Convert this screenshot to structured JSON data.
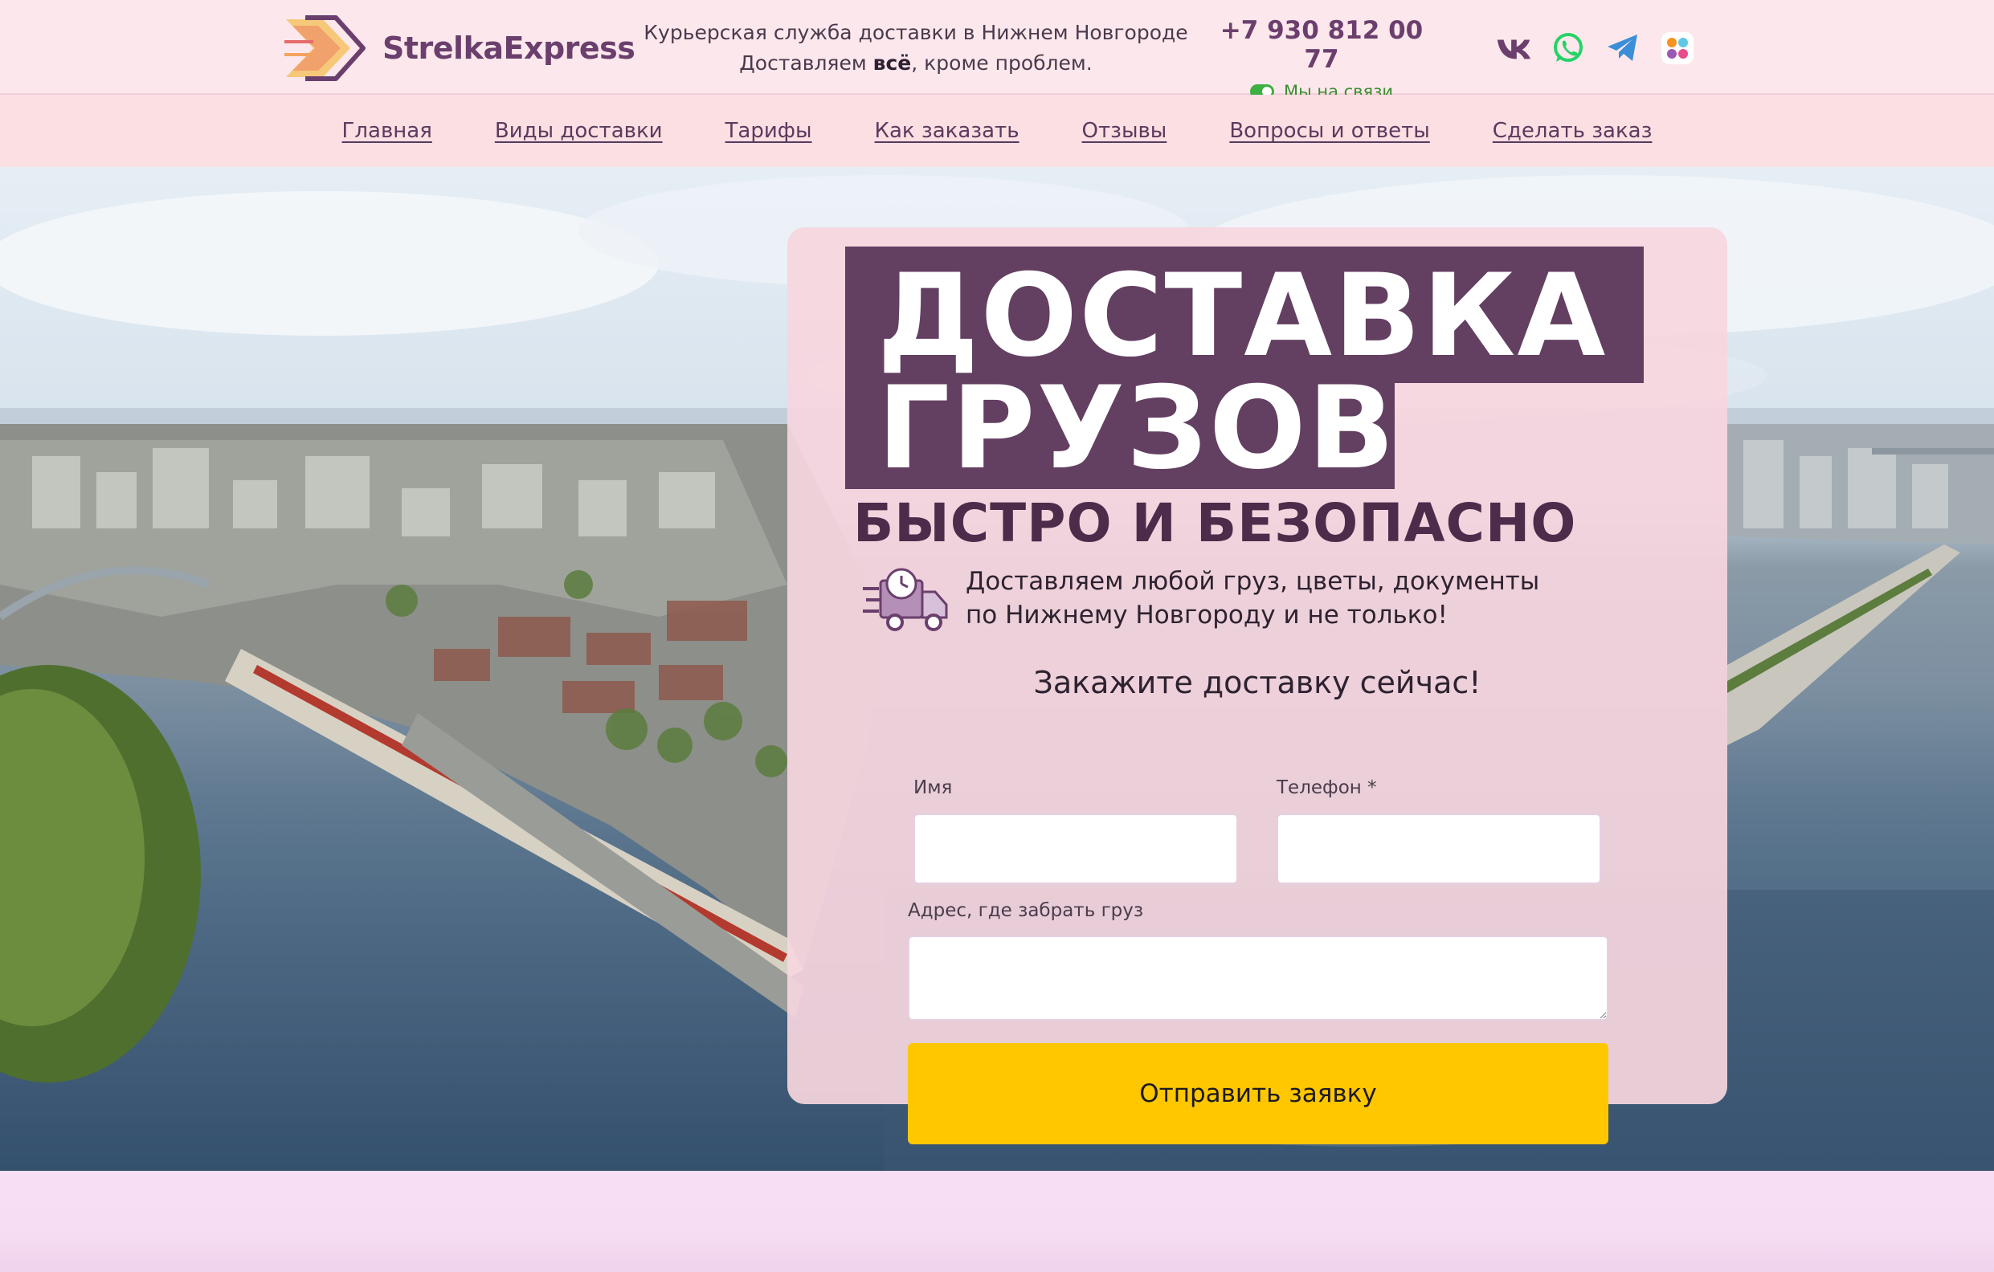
{
  "brand": {
    "name": "StrelkaExpress"
  },
  "header": {
    "tagline_line1": "Курьерская служба доставки в Нижнем Новгороде",
    "tagline_line2_pre": "Доставляем ",
    "tagline_line2_bold": "всё",
    "tagline_line2_post": ", кроме проблем.",
    "phone": "+7 930 812 00 77",
    "status": "Мы на связи"
  },
  "socials": [
    {
      "icon": "vk-icon"
    },
    {
      "icon": "whatsapp-icon"
    },
    {
      "icon": "telegram-icon"
    },
    {
      "icon": "max-messenger-icon"
    }
  ],
  "nav": {
    "items": [
      {
        "label": "Главная"
      },
      {
        "label": "Виды доставки"
      },
      {
        "label": "Тарифы"
      },
      {
        "label": "Как заказать"
      },
      {
        "label": "Отзывы"
      },
      {
        "label": "Вопросы и ответы"
      },
      {
        "label": "Сделать заказ"
      }
    ]
  },
  "hero": {
    "title_line1": "ДОСТАВКА",
    "title_line2": "ГРУЗОВ",
    "subtitle": "БЫСТРО И БЕЗОПАСНО",
    "lead": "Доставляем любой груз, цветы, документы по Нижнему Новгороду и не только!",
    "lead_icon": "fast-delivery-truck-icon"
  },
  "form": {
    "title": "Закажите доставку сейчас!",
    "name_label": "Имя",
    "name_value": "",
    "phone_label": "Телефон *",
    "phone_value": "",
    "address_label": "Адрес, где забрать груз",
    "address_value": "",
    "submit_label": "Отправить заявку"
  },
  "colors": {
    "brand_purple": "#633f62",
    "accent_yellow": "#ffc700",
    "header_bg": "#fce8ec",
    "nav_bg": "#fcdfe3",
    "online_green": "#3cb043"
  }
}
